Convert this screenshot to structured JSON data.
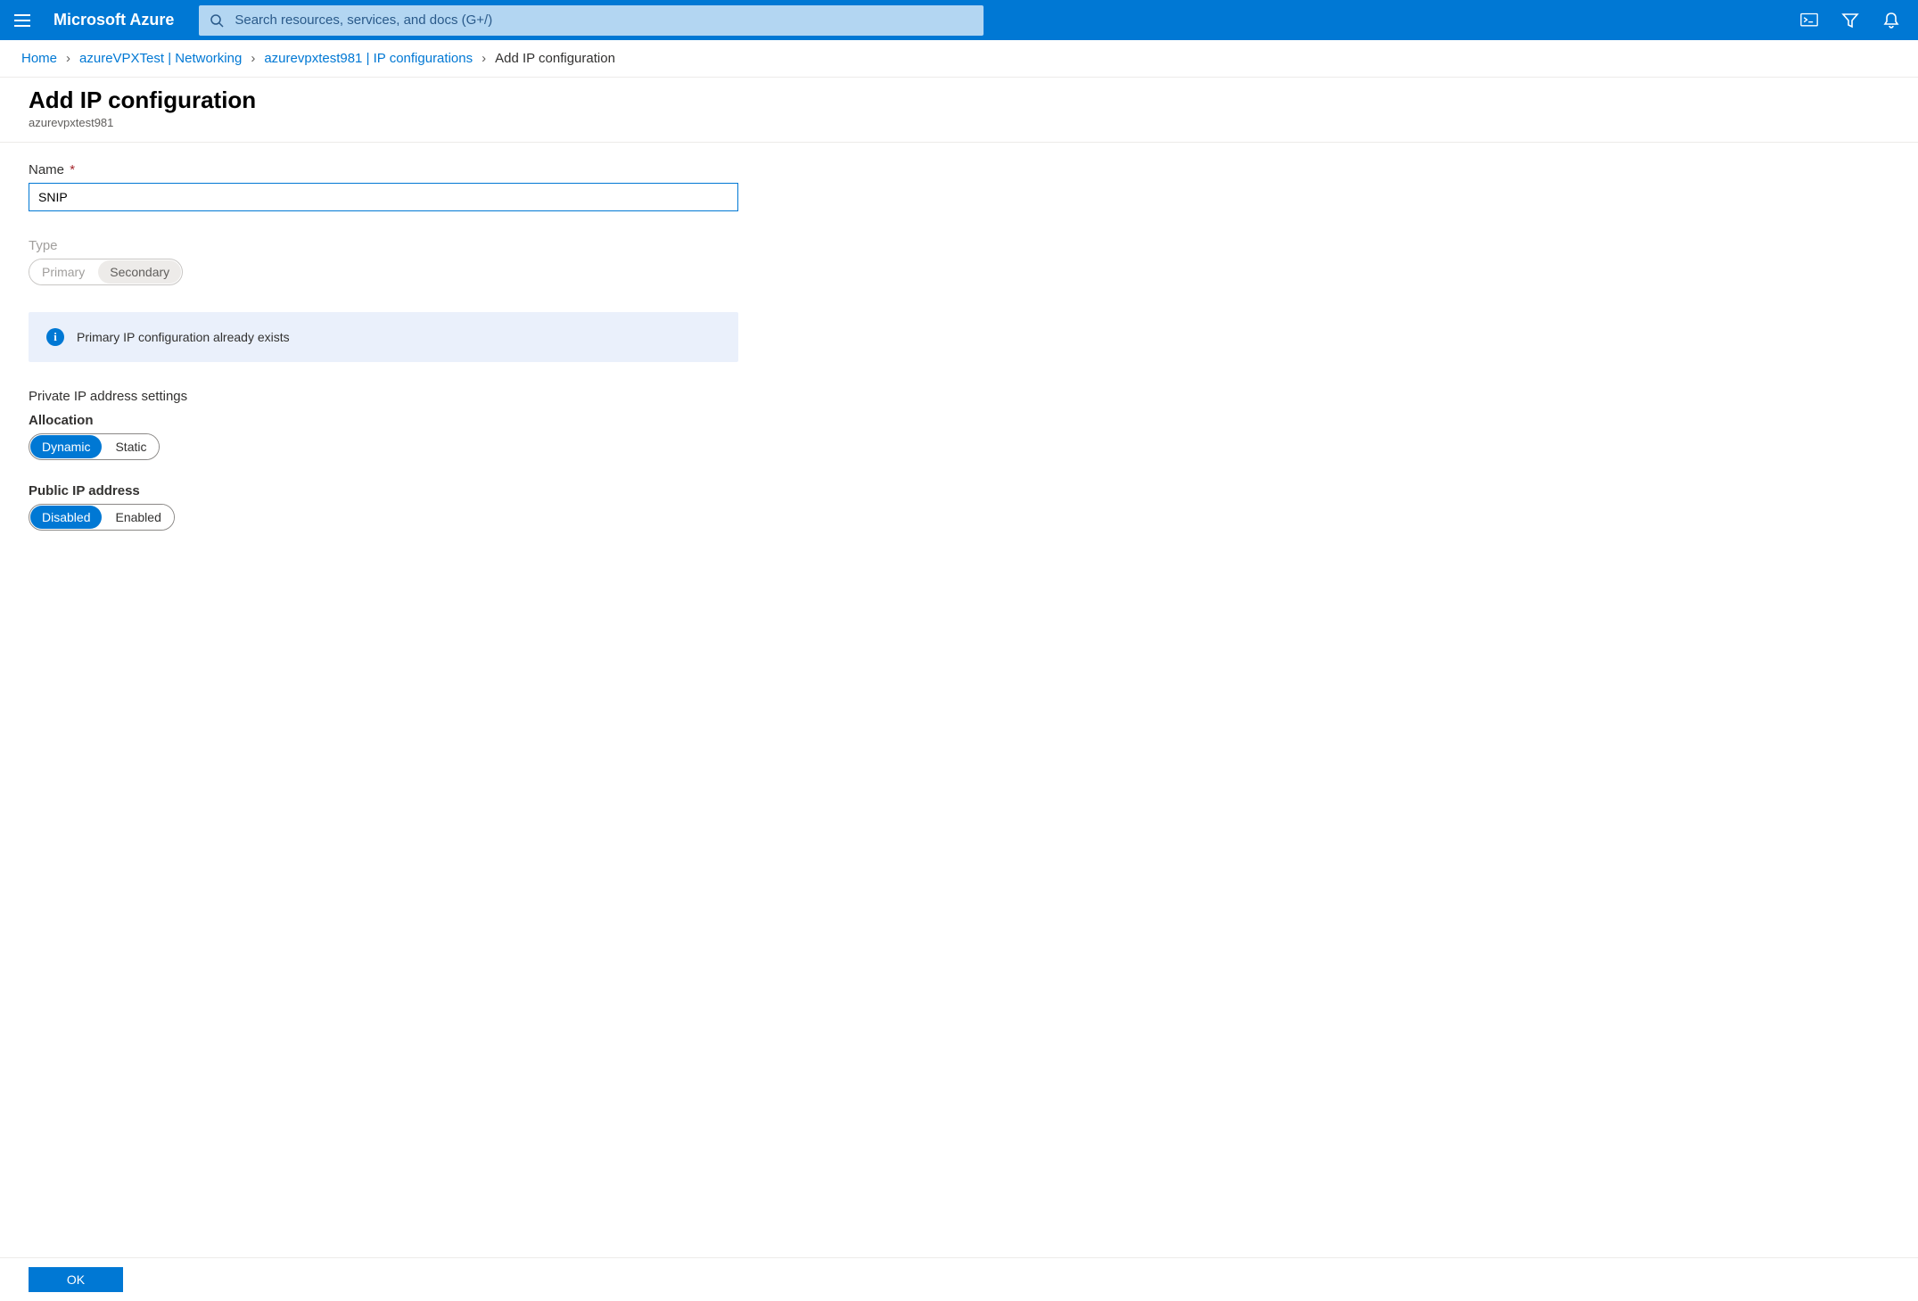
{
  "header": {
    "brand": "Microsoft Azure",
    "search_placeholder": "Search resources, services, and docs (G+/)"
  },
  "breadcrumb": {
    "items": [
      {
        "label": "Home",
        "link": true
      },
      {
        "label": "azureVPXTest | Networking",
        "link": true
      },
      {
        "label": "azurevpxtest981 | IP configurations",
        "link": true
      },
      {
        "label": "Add IP configuration",
        "link": false
      }
    ]
  },
  "page": {
    "title": "Add IP configuration",
    "subtitle": "azurevpxtest981"
  },
  "form": {
    "name": {
      "label": "Name",
      "required_marker": "*",
      "value": "SNIP"
    },
    "type": {
      "label": "Type",
      "options": [
        "Primary",
        "Secondary"
      ],
      "selected": "Secondary",
      "disabled": true
    },
    "info_message": "Primary IP configuration already exists",
    "private_ip": {
      "heading": "Private IP address settings",
      "allocation": {
        "label": "Allocation",
        "options": [
          "Dynamic",
          "Static"
        ],
        "selected": "Dynamic"
      },
      "public_ip": {
        "label": "Public IP address",
        "options": [
          "Disabled",
          "Enabled"
        ],
        "selected": "Disabled"
      }
    }
  },
  "footer": {
    "ok_label": "OK"
  }
}
